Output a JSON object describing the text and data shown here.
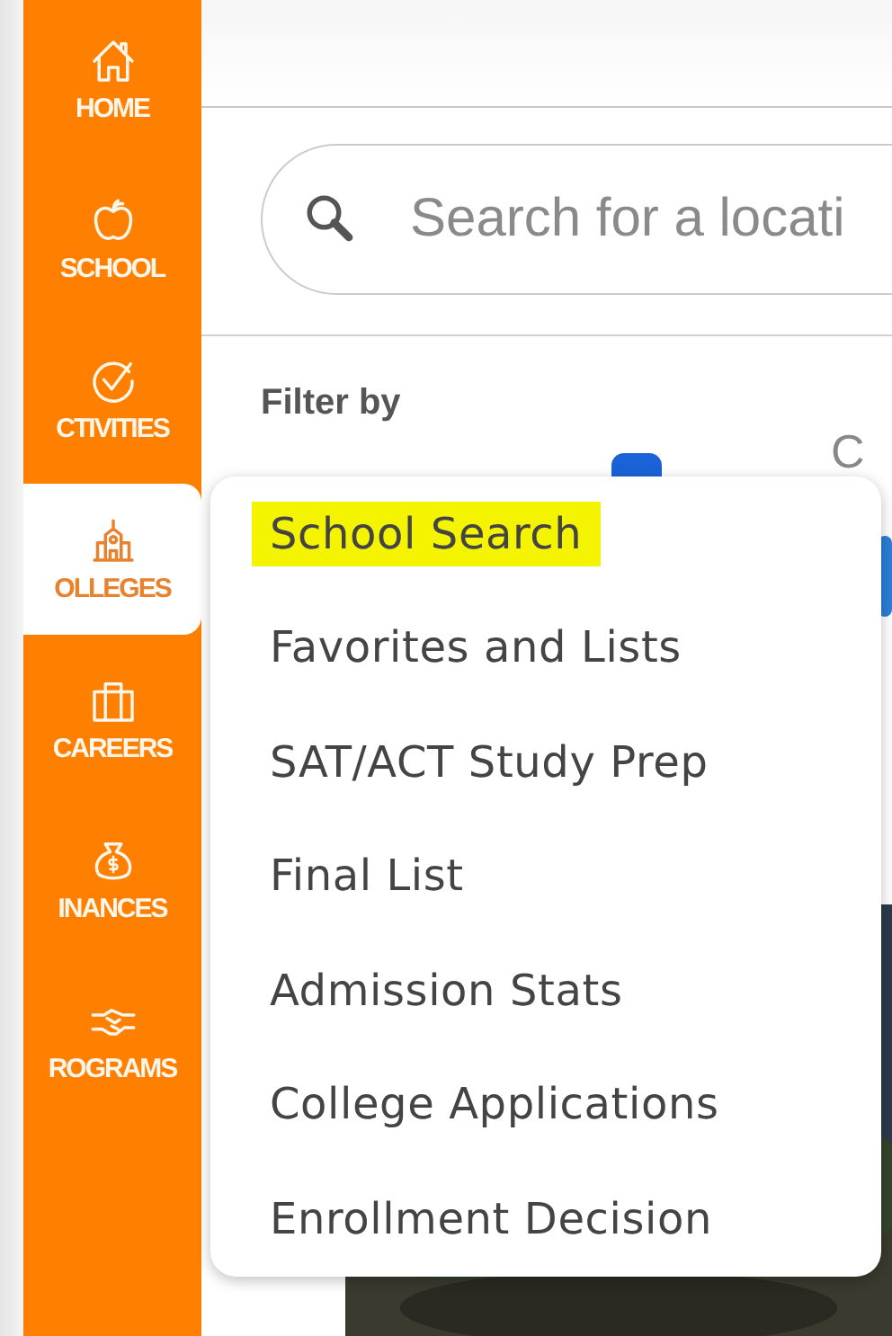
{
  "sidebar": {
    "items": [
      {
        "kind": "home",
        "label": "HOME",
        "selected": false
      },
      {
        "kind": "school",
        "label": "SCHOOL",
        "selected": false
      },
      {
        "kind": "activities",
        "label": "CTIVITIES",
        "selected": false
      },
      {
        "kind": "colleges",
        "label": "OLLEGES",
        "selected": true
      },
      {
        "kind": "careers",
        "label": "CAREERS",
        "selected": false
      },
      {
        "kind": "finances",
        "label": "INANCES",
        "selected": false
      },
      {
        "kind": "programs",
        "label": "ROGRAMS",
        "selected": false
      }
    ]
  },
  "search": {
    "placeholder": "Search for a locati"
  },
  "filters": {
    "title": "Filter by",
    "items": [
      {
        "label": "C"
      }
    ]
  },
  "menu": {
    "items": [
      {
        "label": "School Search",
        "highlighted": true
      },
      {
        "label": "Favorites and Lists",
        "highlighted": false
      },
      {
        "label": "SAT/ACT Study Prep",
        "highlighted": false
      },
      {
        "label": "Final List",
        "highlighted": false
      },
      {
        "label": "Admission Stats",
        "highlighted": false
      },
      {
        "label": "College Applications",
        "highlighted": false
      },
      {
        "label": "Enrollment Decision",
        "highlighted": false
      }
    ]
  }
}
